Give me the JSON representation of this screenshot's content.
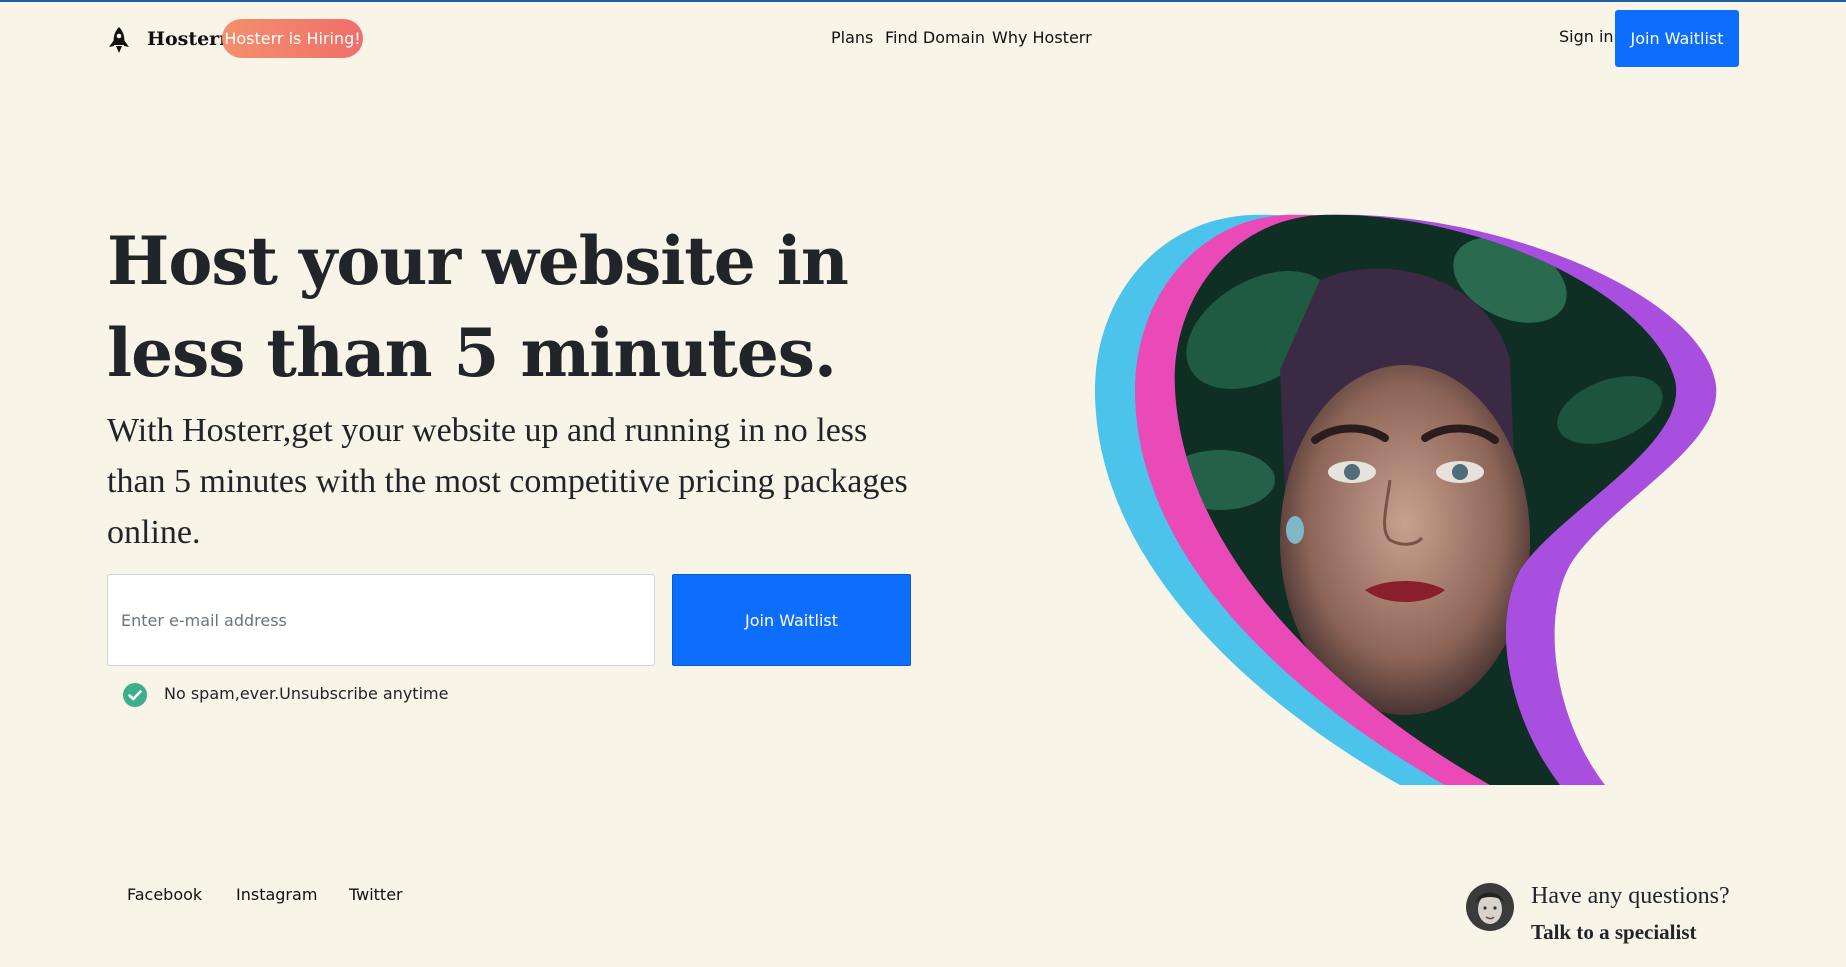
{
  "header": {
    "brand": "Hosterr",
    "hiring_badge": "Hosterr is Hiring!",
    "nav": [
      "Plans",
      "Find Domain",
      "Why Hosterr"
    ],
    "sign_in": "Sign in",
    "join_button": "Join Waitlist"
  },
  "hero": {
    "title_line1": "Host your website in",
    "title_line2": "less than 5 minutes.",
    "subtitle": "With Hosterr,get your website up and running in no less than 5 minutes with the most competitive pricing packages online.",
    "email_placeholder": "Enter e-mail address",
    "join_button": "Join Waitlist",
    "no_spam": "No spam,ever.Unsubscribe anytime"
  },
  "footer": {
    "social": [
      "Facebook",
      "Instagram",
      "Twitter"
    ],
    "question": "Have any questions?",
    "specialist": "Talk to a specialist"
  },
  "colors": {
    "background": "#f8f4e8",
    "primary": "#0d6efd",
    "hiring_gradient": [
      "#f4906c",
      "#ef6f6a"
    ],
    "blob_cyan": "#4cc3ea",
    "blob_pink": "#e94ab8",
    "blob_purple": "#a84fe0",
    "check_green": "#3fae8f"
  },
  "icons": {
    "logo": "rocket-icon",
    "check": "check-circle-icon"
  }
}
